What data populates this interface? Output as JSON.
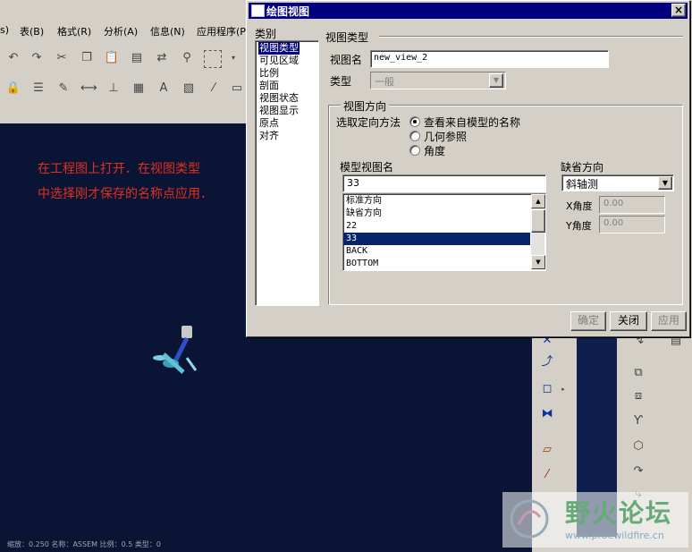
{
  "menubar": {
    "items": [
      "s)",
      "表(B)",
      "格式(R)",
      "分析(A)",
      "信息(N)",
      "应用程序(P"
    ]
  },
  "canvas": {
    "note_line1": "在工程图上打开．在视图类型",
    "note_line2": "中选择刚才保存的名称点应用．",
    "status": "缩放：0.250  名称：ASSEM  比例：0.5  类型：0"
  },
  "dialog": {
    "title": "绘图视图",
    "close_symbol": "×",
    "category_label": "类别",
    "categories": [
      "视图类型",
      "可见区域",
      "比例",
      "剖面",
      "视图状态",
      "视图显示",
      "原点",
      "对齐"
    ],
    "view_type_header": "视图类型",
    "view_name_label": "视图名",
    "view_name_value": "new_view_2",
    "type_label": "类型",
    "type_value": "一般",
    "orientation_group": "视图方向",
    "orient_method_label": "选取定向方法",
    "orient_options": [
      "查看来自模型的名称",
      "几何参照",
      "角度"
    ],
    "model_view_name_label": "模型视图名",
    "model_view_name_value": "33",
    "model_views": [
      "标准方向",
      "缺省方向",
      "22",
      "33",
      "BACK",
      "BOTTOM"
    ],
    "default_orient_label": "缺省方向",
    "default_orient_value": "斜轴测",
    "x_angle_label": "X角度",
    "x_angle_value": "0.00",
    "y_angle_label": "Y角度",
    "y_angle_value": "0.00",
    "ok_label": "确定",
    "close_label": "关闭",
    "apply_label": "应用"
  },
  "watermark": {
    "title": "野火论坛",
    "url": "www.proewildfire.cn"
  },
  "colors": {
    "titlebar": "#000080",
    "canvas": "#0a1535",
    "note_text": "#e03020",
    "selection": "#0a246a"
  }
}
